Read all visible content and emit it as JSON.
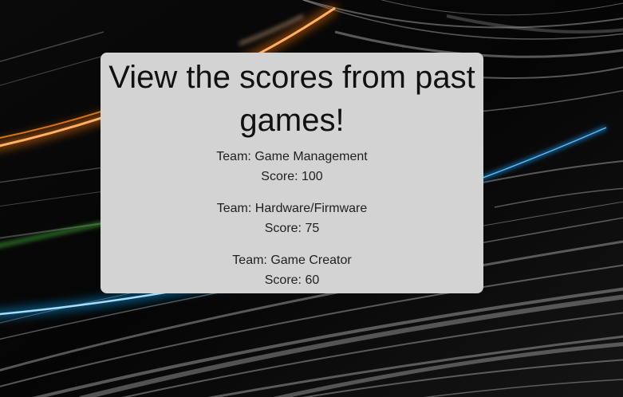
{
  "page": {
    "heading": "View the scores from past games!"
  },
  "scores": [
    {
      "team_prefix": "Team:",
      "team": "Game Management",
      "score_prefix": "Score:",
      "score": "100"
    },
    {
      "team_prefix": "Team:",
      "team": "Hardware/Firmware",
      "score_prefix": "Score:",
      "score": "75"
    },
    {
      "team_prefix": "Team:",
      "team": "Game Creator",
      "score_prefix": "Score:",
      "score": "60"
    }
  ],
  "colors": {
    "panel_background": "#d3d3d3",
    "page_background": "#050505",
    "streak_orange": "#ff8a1f",
    "streak_blue": "#1aa8ff",
    "streak_green": "#3fae3a"
  }
}
